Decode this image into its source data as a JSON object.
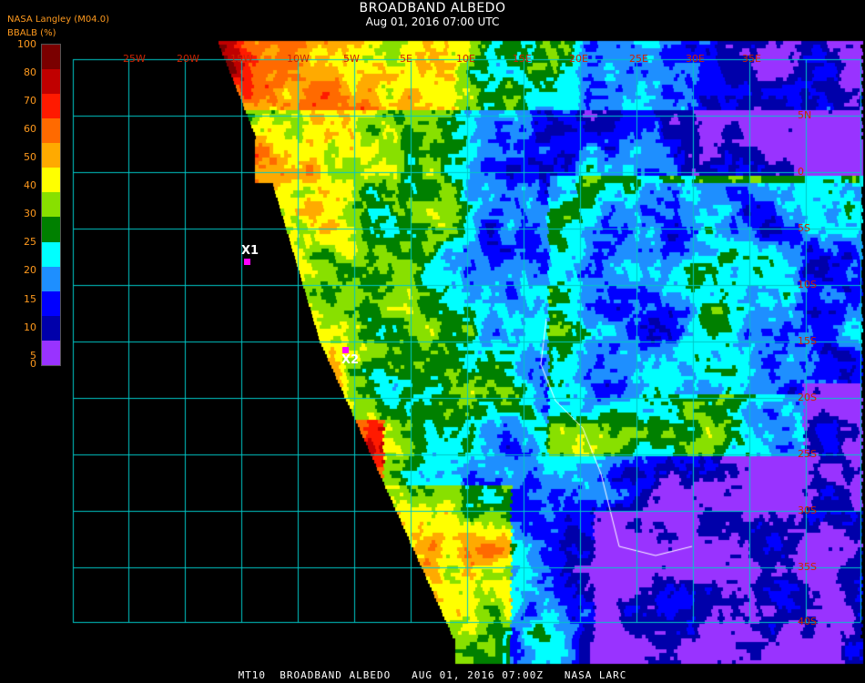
{
  "title": "BROADBAND ALBEDO",
  "subtitle": "Aug 01, 2016 07:00 UTC",
  "provider": "NASA Langley (M04.0)",
  "parameter": "BBALB (%)",
  "footer": "MT10  BROADBAND ALBEDO   AUG 01, 2016 07:00Z   NASA LARC",
  "legend": {
    "ticks": [
      "100",
      "80",
      "70",
      "60",
      "50",
      "40",
      "30",
      "25",
      "20",
      "15",
      "10",
      "5",
      "0"
    ],
    "colors": [
      "#7a0000",
      "#c00000",
      "#ff1a00",
      "#ff6a00",
      "#ffaa00",
      "#ffff00",
      "#88e000",
      "#008000",
      "#00ffff",
      "#1e8fff",
      "#0000ff",
      "#0000aa",
      "#9933ff"
    ]
  },
  "grid": {
    "color": "#00c8c8",
    "longitude_labels": [
      "25W",
      "20W",
      "15W",
      "10W",
      "5W",
      "5E",
      "10E",
      "15E",
      "20E",
      "25E",
      "30E",
      "35E"
    ],
    "latitude_labels": [
      "5N",
      "0",
      "5S",
      "10S",
      "15S",
      "20S",
      "25S",
      "30S",
      "35S",
      "40S"
    ]
  },
  "markers": [
    {
      "label": "X1"
    },
    {
      "label": "X2"
    }
  ],
  "colors": {
    "text": "#ffffff",
    "legend_text": "#ff9a1e",
    "grid": "#00c8c8",
    "marker": "#ff00ff"
  }
}
